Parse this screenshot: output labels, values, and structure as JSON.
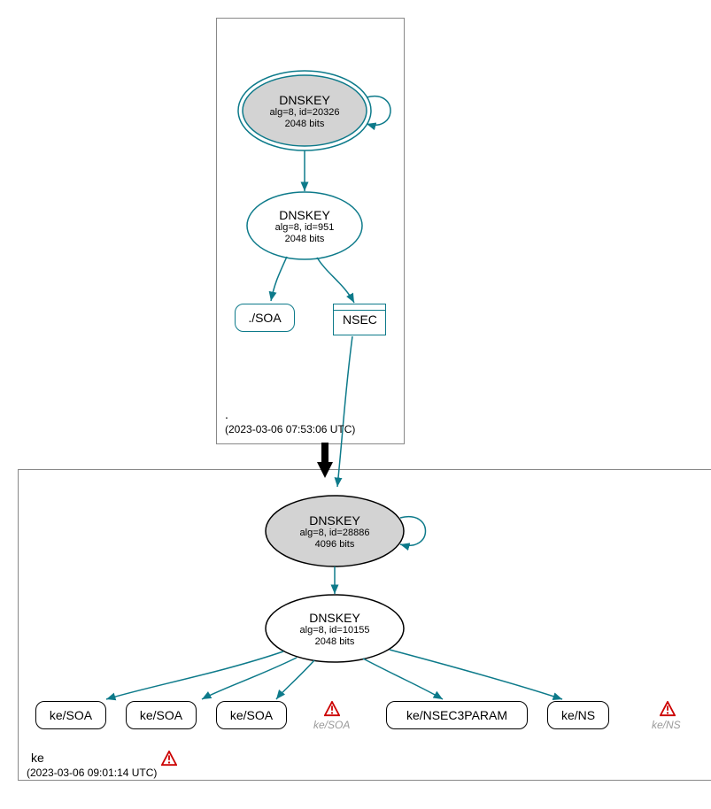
{
  "zones": {
    "root": {
      "name": ".",
      "timestamp": "(2023-03-06 07:53:06 UTC)"
    },
    "ke": {
      "name": "ke",
      "timestamp": "(2023-03-06 09:01:14 UTC)"
    }
  },
  "nodes": {
    "root_ksk": {
      "title": "DNSKEY",
      "alg": "alg=8, id=20326",
      "bits": "2048 bits"
    },
    "root_zsk": {
      "title": "DNSKEY",
      "alg": "alg=8, id=951",
      "bits": "2048 bits"
    },
    "root_soa": {
      "label": "./SOA"
    },
    "root_nsec": {
      "label": "NSEC"
    },
    "ke_ksk": {
      "title": "DNSKEY",
      "alg": "alg=8, id=28886",
      "bits": "4096 bits"
    },
    "ke_zsk": {
      "title": "DNSKEY",
      "alg": "alg=8, id=10155",
      "bits": "2048 bits"
    },
    "ke_soa1": {
      "label": "ke/SOA"
    },
    "ke_soa2": {
      "label": "ke/SOA"
    },
    "ke_soa3": {
      "label": "ke/SOA"
    },
    "ke_soa_warn": {
      "label": "ke/SOA"
    },
    "ke_nsec3param": {
      "label": "ke/NSEC3PARAM"
    },
    "ke_ns": {
      "label": "ke/NS"
    },
    "ke_ns_warn": {
      "label": "ke/NS"
    }
  }
}
